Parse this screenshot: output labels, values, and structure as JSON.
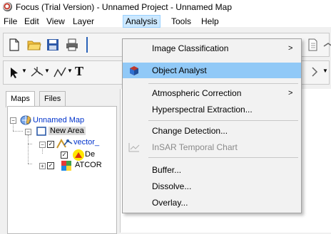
{
  "window": {
    "title": "Focus (Trial Version) - Unnamed Project - Unnamed Map"
  },
  "menubar": {
    "items": [
      "File",
      "Edit",
      "View",
      "Layer",
      "Analysis",
      "Tools",
      "Help"
    ],
    "active": "Analysis"
  },
  "left_panel": {
    "tabs": [
      "Maps",
      "Files"
    ],
    "selected_tab": "Maps",
    "tree": {
      "root": "Unnamed Map",
      "area": "New Area",
      "layer1": "vector_",
      "layer1_child": "De",
      "layer2": "ATCOR"
    }
  },
  "analysis_menu": {
    "items": [
      {
        "label": "Image Classification",
        "submenu": true,
        "enabled": true
      },
      {
        "label": "Object Analyst",
        "submenu": false,
        "enabled": true,
        "highlighted": true,
        "icon": "object-analyst-icon"
      },
      {
        "label": "Atmospheric Correction",
        "submenu": true,
        "enabled": true
      },
      {
        "label": "Hyperspectral Extraction...",
        "submenu": false,
        "enabled": true
      },
      {
        "label": "Change Detection...",
        "submenu": false,
        "enabled": true
      },
      {
        "label": "InSAR Temporal Chart",
        "submenu": false,
        "enabled": false,
        "icon": "chart-icon"
      },
      {
        "label": "Buffer...",
        "submenu": false,
        "enabled": true
      },
      {
        "label": "Dissolve...",
        "submenu": false,
        "enabled": true
      },
      {
        "label": "Overlay...",
        "submenu": false,
        "enabled": true
      }
    ],
    "submenu_arrow": ">"
  },
  "colors": {
    "highlight": "#91c9f7",
    "menu_active": "#cce8ff",
    "link_blue": "#0033cc"
  }
}
